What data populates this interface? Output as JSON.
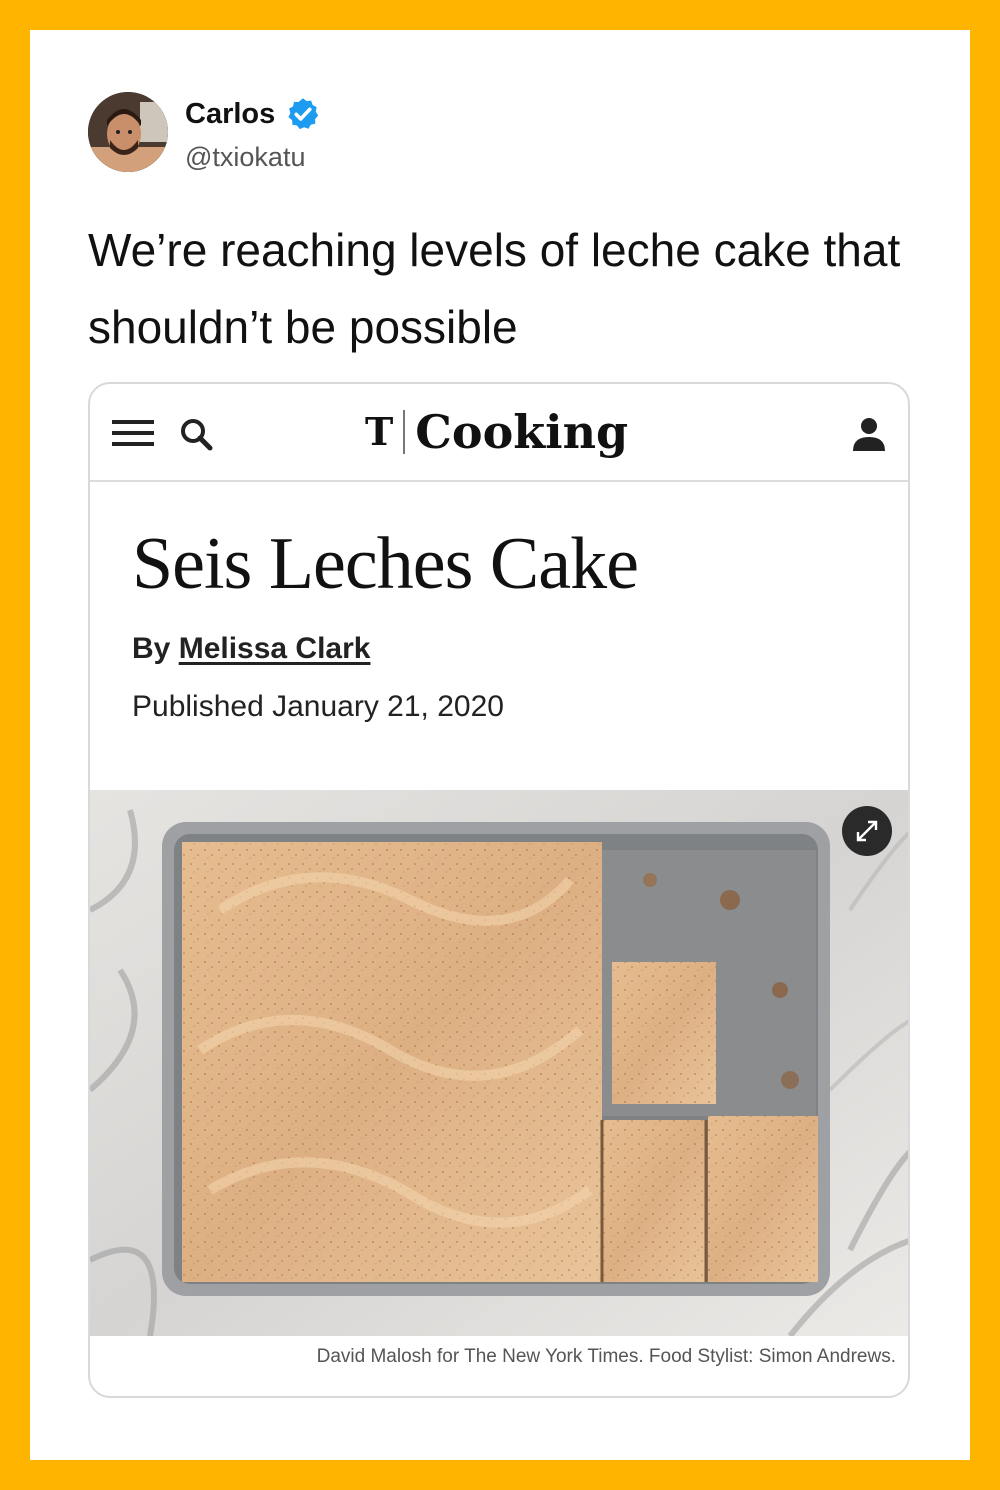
{
  "tweet": {
    "author_name": "Carlos",
    "handle": "@txiokatu",
    "verified": true,
    "text": "We’re reaching levels of leche cake that shouldn’t be possible"
  },
  "embed": {
    "header": {
      "brand_logo": "T",
      "brand_name": "Cooking",
      "icons": [
        "menu-icon",
        "search-icon",
        "account-icon"
      ]
    },
    "recipe": {
      "title": "Seis Leches Cake",
      "by_label": "By",
      "author": "Melissa Clark",
      "published": "Published January 21, 2020"
    },
    "photo": {
      "expand_icon": "expand-icon",
      "caption": "David Malosh for The New York Times. Food Stylist: Simon Andrews."
    }
  },
  "colors": {
    "frame": "#FFB500",
    "verified_blue": "#1D9BF0",
    "frosting": "#E3B98C"
  }
}
